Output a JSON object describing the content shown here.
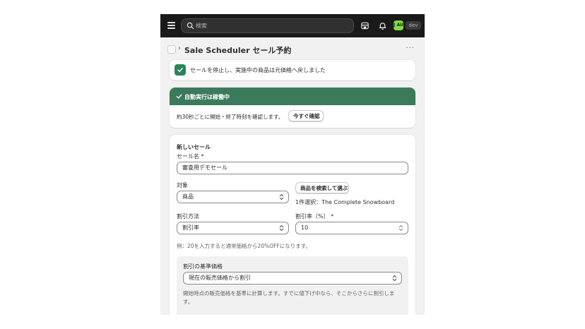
{
  "topbar": {
    "search_placeholder": "検索",
    "avatar_initials": "J AU",
    "env_badge": "dev",
    "icons": [
      "menu-icon",
      "search-icon",
      "store-icon",
      "bell-icon"
    ]
  },
  "page": {
    "title": "Sale Scheduler セール予約",
    "more": "···"
  },
  "toast": {
    "message": "セールを停止し、実施中の商品は元価格へ戻しました"
  },
  "status": {
    "title": "自動実行は稼働中",
    "description": "約30秒ごとに開始・終了時刻を確認します。",
    "check_now_label": "今すぐ確認",
    "header_color": "#3b7a5b"
  },
  "form": {
    "section_title": "新しいセール",
    "sale_name_label": "セール名 *",
    "sale_name_value": "審査用デモセール",
    "target_label": "対象",
    "target_value": "商品",
    "pick_product_label": "商品を検索して選ぶ",
    "picked_summary": "1件選択：The Complete Snowboard",
    "discount_method_label": "割引方法",
    "discount_method_value": "割引率",
    "discount_rate_label": "割引率（%） *",
    "discount_rate_value": "10",
    "example_text": "例：20を入力すると通常価格から20%OFFになります。",
    "base_price_label": "割引の基準価格",
    "base_price_value": "現在の販売価格から割引",
    "base_price_help": "開始時点の販売価格を基準に計算します。すでに値下げ中なら、そこからさらに割引します。"
  },
  "colors": {
    "success": "#29845a",
    "topbar": "#1a1a1a",
    "avatar": "#7ee03a"
  }
}
